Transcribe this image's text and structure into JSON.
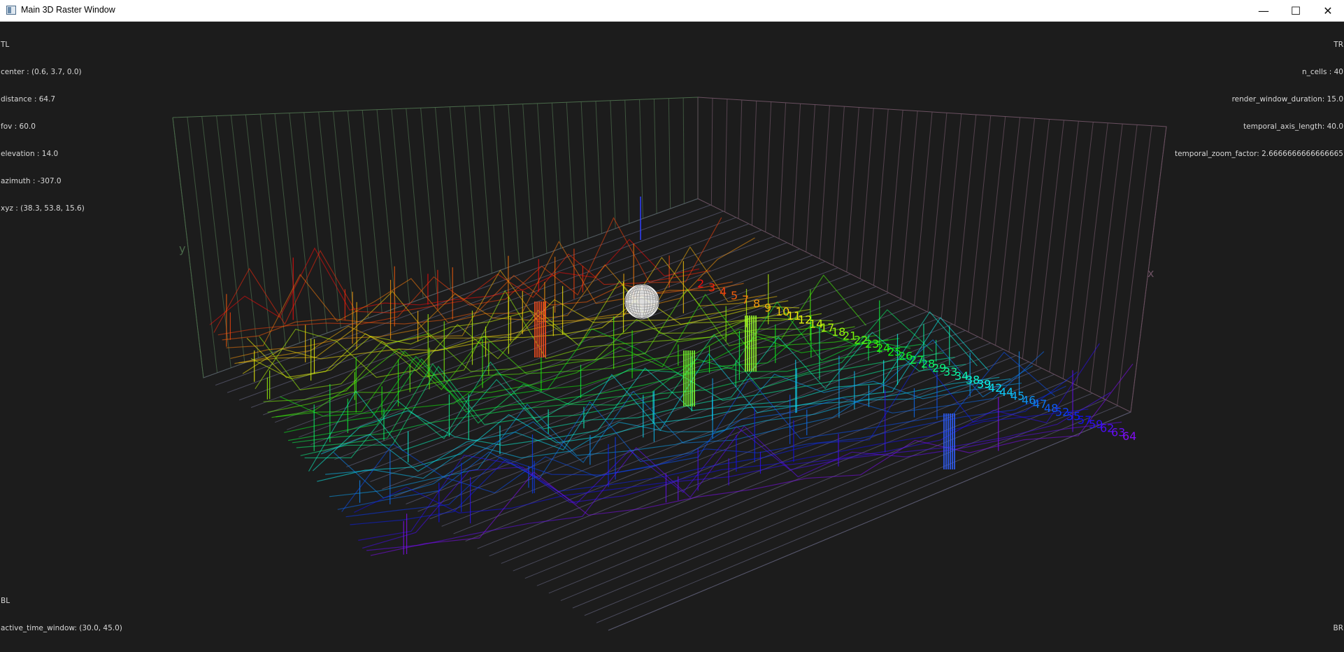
{
  "window": {
    "title": "Main 3D Raster Window",
    "minimize_glyph": "—",
    "maximize_glyph": "☐",
    "close_glyph": "✕"
  },
  "hud": {
    "top_left": {
      "corner": "TL",
      "center": "center : (0.6, 3.7, 0.0)",
      "distance": "distance : 64.7",
      "fov": "fov : 60.0",
      "elevation": "elevation : 14.0",
      "azimuth": "azimuth : -307.0",
      "xyz": "xyz : (38.3, 53.8, 15.6)"
    },
    "top_right": {
      "corner": "TR",
      "n_cells": "n_cells : 40",
      "render_window_duration": "render_window_duration: 15.0",
      "temporal_axis_length": "temporal_axis_length: 40.0",
      "temporal_zoom_factor": "temporal_zoom_factor: 2.6666666666666665"
    },
    "bottom_left": {
      "corner": "BL",
      "active_time_window": "active_time_window: (30.0, 45.0)"
    },
    "bottom_right": {
      "corner": "BR"
    }
  },
  "scene": {
    "axis_labels": {
      "x": "x",
      "y": "y"
    },
    "cell_labels": [
      "2",
      "3",
      "4",
      "5",
      "7",
      "8",
      "9",
      "10",
      "11",
      "12",
      "14",
      "17",
      "18",
      "21",
      "22",
      "23",
      "24",
      "25",
      "26",
      "27",
      "28",
      "29",
      "33",
      "34",
      "38",
      "39",
      "42",
      "44",
      "45",
      "46",
      "47",
      "48",
      "52",
      "55",
      "57",
      "59",
      "62",
      "63",
      "64"
    ],
    "colors": {
      "background": "#1c1c1c",
      "grid_yz": "#4a6a4a",
      "grid_xz": "#6a5060",
      "floor": "#55556a",
      "sphere": "#ffffff"
    }
  }
}
